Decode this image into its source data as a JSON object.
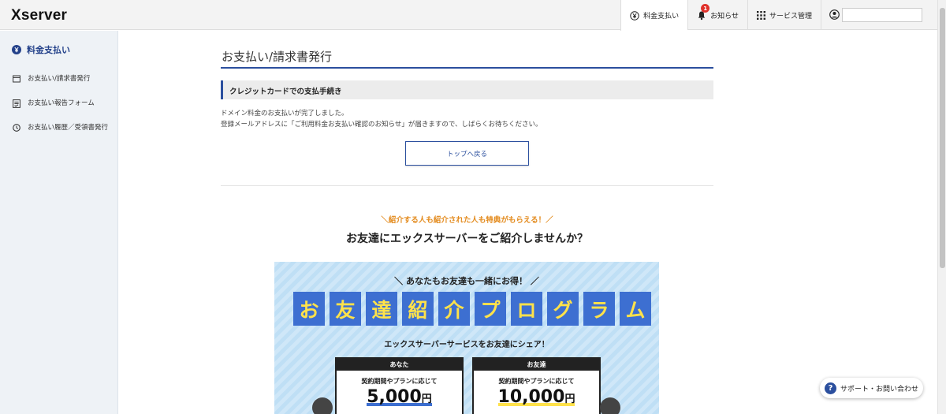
{
  "header": {
    "logo": "Xserver",
    "nav": [
      {
        "label": "料金支払い",
        "icon": "yen-icon"
      },
      {
        "label": "お知らせ",
        "icon": "bell-icon",
        "badge": "1"
      },
      {
        "label": "サービス管理",
        "icon": "grid-icon"
      }
    ],
    "user_icon": "user-icon"
  },
  "sidebar": {
    "heading": "料金支払い",
    "items": [
      {
        "label": "お支払い/請求書発行",
        "icon": "invoice-icon"
      },
      {
        "label": "お支払い報告フォーム",
        "icon": "form-icon"
      },
      {
        "label": "お支払い履歴／受領書発行",
        "icon": "history-icon"
      }
    ]
  },
  "main": {
    "title": "お支払い/請求書発行",
    "section": "クレジットカードでの支払手続き",
    "message_line1": "ドメイン料金のお支払いが完了しました。",
    "message_line2": "登録メールアドレスに「ご利用料金お支払い確認のお知らせ」が届きますので、しばらくお待ちください。",
    "back_button": "トップへ戻る",
    "referral_tag": "＼紹介する人も紹介された人も特典がもらえる！／",
    "referral_title": "お友達にエックスサーバーをご紹介しませんか？"
  },
  "banner": {
    "subtitle": "＼ あなたもお友達も一緒にお得！ ／",
    "title_chars": [
      "お",
      "友",
      "達",
      "紹",
      "介",
      "プ",
      "ロ",
      "グ",
      "ラ",
      "ム"
    ],
    "share": "エックスサーバーサービスをお友達にシェア！",
    "you": {
      "caption": "あなた",
      "desc": "契約期間やプランに応じて",
      "amount": "5,000",
      "unit": "円"
    },
    "friend": {
      "caption": "お友達",
      "desc": "契約期間やプランに応じて",
      "amount": "10,000",
      "unit": "円"
    },
    "colors": {
      "tile": "#3d6fd1",
      "text": "#ffe24a"
    }
  },
  "support": {
    "label": "サポート・お問い合わせ"
  }
}
